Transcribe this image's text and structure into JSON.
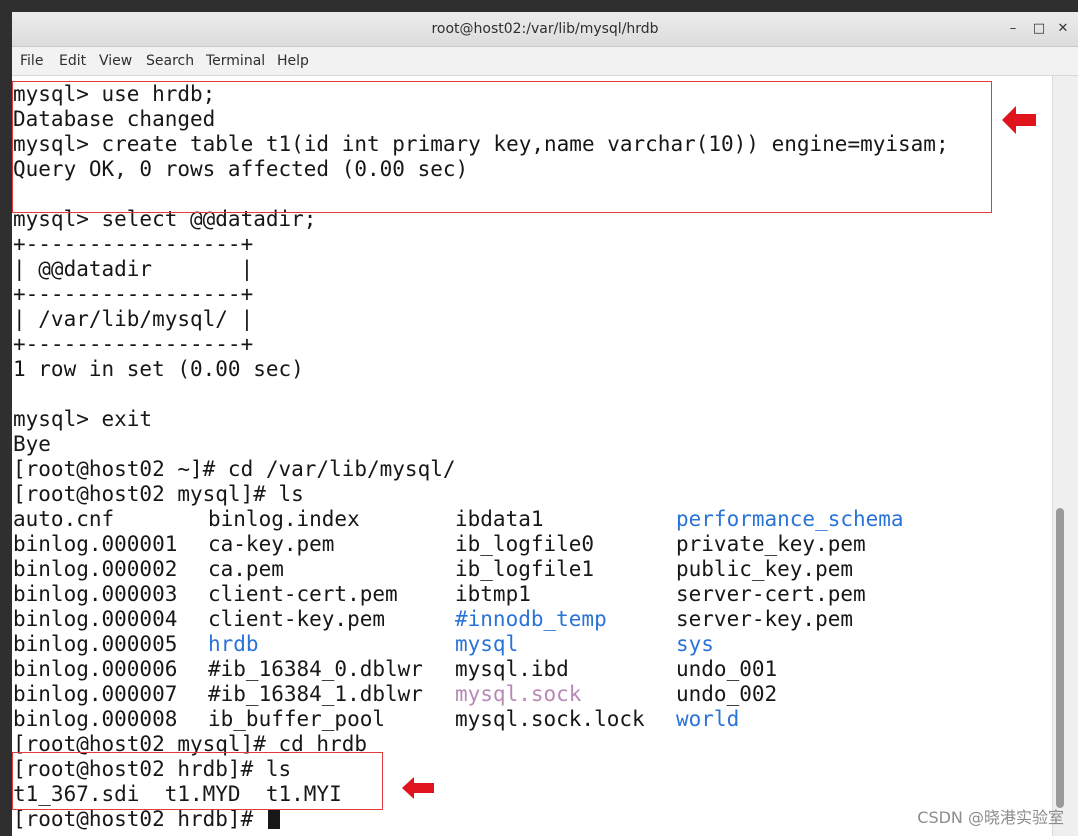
{
  "window": {
    "title": "root@host02:/var/lib/mysql/hrdb",
    "minimize_glyph": "–",
    "maximize_glyph": "□",
    "close_glyph": "✕"
  },
  "menu": [
    "File",
    "Edit",
    "View",
    "Search",
    "Terminal",
    "Help"
  ],
  "terminal": {
    "lines_before_ls": [
      "mysql> use hrdb;",
      "Database changed",
      "mysql> create table t1(id int primary key,name varchar(10)) engine=myisam;",
      "Query OK, 0 rows affected (0.00 sec)",
      "",
      "mysql> select @@datadir;",
      "+-----------------+",
      "| @@datadir       |",
      "+-----------------+",
      "| /var/lib/mysql/ |",
      "+-----------------+",
      "1 row in set (0.00 sec)",
      "",
      "mysql> exit",
      "Bye",
      "[root@host02 ~]# cd /var/lib/mysql/",
      "[root@host02 mysql]# ls"
    ],
    "ls_rows": [
      [
        {
          "t": "auto.cnf",
          "c": "file"
        },
        {
          "t": "binlog.index",
          "c": "file"
        },
        {
          "t": "ibdata1",
          "c": "file"
        },
        {
          "t": "performance_schema",
          "c": "dir"
        }
      ],
      [
        {
          "t": "binlog.000001",
          "c": "file"
        },
        {
          "t": "ca-key.pem",
          "c": "file"
        },
        {
          "t": "ib_logfile0",
          "c": "file"
        },
        {
          "t": "private_key.pem",
          "c": "file"
        }
      ],
      [
        {
          "t": "binlog.000002",
          "c": "file"
        },
        {
          "t": "ca.pem",
          "c": "file"
        },
        {
          "t": "ib_logfile1",
          "c": "file"
        },
        {
          "t": "public_key.pem",
          "c": "file"
        }
      ],
      [
        {
          "t": "binlog.000003",
          "c": "file"
        },
        {
          "t": "client-cert.pem",
          "c": "file"
        },
        {
          "t": "ibtmp1",
          "c": "file"
        },
        {
          "t": "server-cert.pem",
          "c": "file"
        }
      ],
      [
        {
          "t": "binlog.000004",
          "c": "file"
        },
        {
          "t": "client-key.pem",
          "c": "file"
        },
        {
          "t": "#innodb_temp",
          "c": "dir"
        },
        {
          "t": "server-key.pem",
          "c": "file"
        }
      ],
      [
        {
          "t": "binlog.000005",
          "c": "file"
        },
        {
          "t": "hrdb",
          "c": "dir"
        },
        {
          "t": "mysql",
          "c": "dir"
        },
        {
          "t": "sys",
          "c": "dir"
        }
      ],
      [
        {
          "t": "binlog.000006",
          "c": "file"
        },
        {
          "t": "#ib_16384_0.dblwr",
          "c": "file"
        },
        {
          "t": "mysql.ibd",
          "c": "file"
        },
        {
          "t": "undo_001",
          "c": "file"
        }
      ],
      [
        {
          "t": "binlog.000007",
          "c": "file"
        },
        {
          "t": "#ib_16384_1.dblwr",
          "c": "file"
        },
        {
          "t": "mysql.sock",
          "c": "sock"
        },
        {
          "t": "undo_002",
          "c": "file"
        }
      ],
      [
        {
          "t": "binlog.000008",
          "c": "file"
        },
        {
          "t": "ib_buffer_pool",
          "c": "file"
        },
        {
          "t": "mysql.sock.lock",
          "c": "file"
        },
        {
          "t": "world",
          "c": "dir"
        }
      ]
    ],
    "lines_after_ls": [
      "[root@host02 mysql]# cd hrdb",
      "[root@host02 hrdb]# ls",
      "t1_367.sdi  t1.MYD  t1.MYI"
    ],
    "prompt_line": "[root@host02 hrdb]# ",
    "colors": {
      "dir": "#2a73d8",
      "sock": "#b68ab4",
      "text": "#171717",
      "highlight": "#e23b3b"
    }
  },
  "watermark": "CSDN @晓港实验室"
}
